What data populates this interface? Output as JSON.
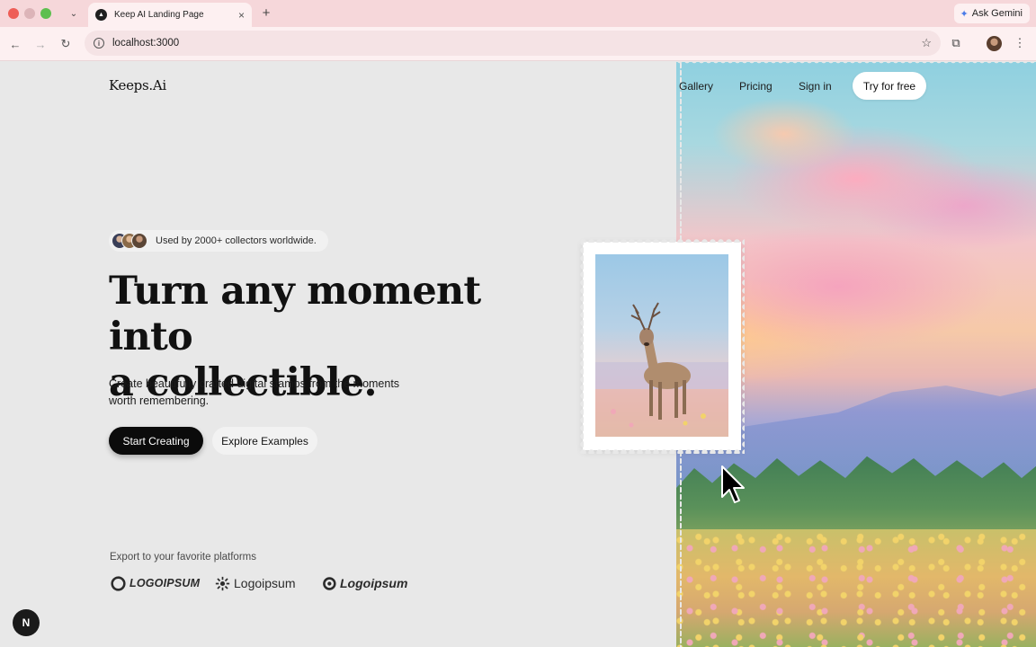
{
  "browser": {
    "tab_title": "Keep AI Landing Page",
    "tab_close_glyph": "×",
    "new_tab_glyph": "+",
    "tab_list_glyph": "⌄",
    "gemini_label": "Ask Gemini",
    "url": "localhost:3000",
    "icons": [
      "back-arrow-icon",
      "forward-arrow-icon",
      "reload-icon",
      "site-info-icon",
      "bookmark-star-icon",
      "extensions-icon",
      "profile-avatar",
      "more-menu-icon"
    ]
  },
  "header": {
    "logo": "Keeps.Ai",
    "nav": [
      "Gallery",
      "Pricing",
      "Sign in"
    ],
    "cta": "Try for free"
  },
  "hero": {
    "social_proof": "Used by 2000+ collectors worldwide.",
    "headline_line1": "Turn any moment into",
    "headline_line2": "a collectible.",
    "subhead_line1": "Create beautifully crafted digital stamps from the moments",
    "subhead_line2": "worth remembering.",
    "primary_button": "Start Creating",
    "secondary_button": "Explore Examples"
  },
  "export": {
    "label": "Export to your favorite platforms",
    "brands": [
      "LOGOIPSUM",
      "Logoipsum",
      "Logoipsum"
    ]
  },
  "dev_badge": "N",
  "colors": {
    "tabbar": "#f6d7da",
    "toolbar": "#fdf0f1",
    "page_bg": "#e8e8e8",
    "primary_button": "#0b0b0b"
  }
}
